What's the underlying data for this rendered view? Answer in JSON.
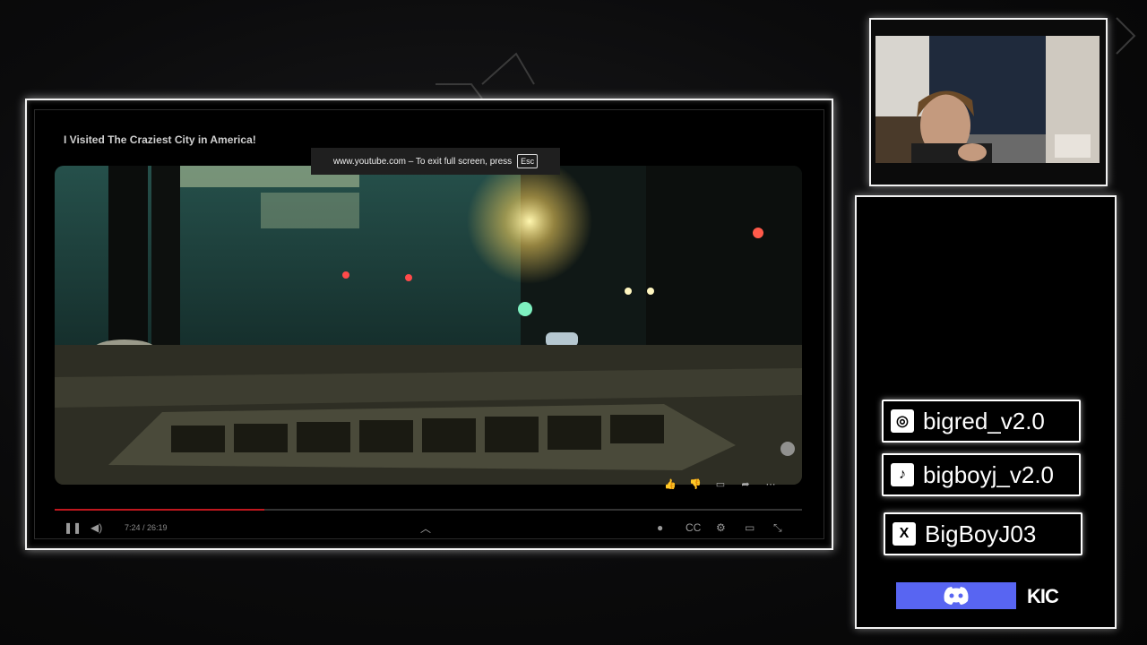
{
  "video": {
    "title": "I Visited The Craziest City in America!",
    "fullscreen_notice": "www.youtube.com – To exit full screen, press",
    "esc_key": "Esc",
    "time": "7:24 / 26:19",
    "progress": 0.28
  },
  "icons": {
    "action_bar": [
      "thumbs-up-icon",
      "thumbs-down-icon",
      "comment-icon",
      "share-icon",
      "more-icon"
    ],
    "controls": [
      "pause-icon",
      "volume-icon",
      "chevron-up-icon",
      "autoplay-icon",
      "captions-icon",
      "settings-icon",
      "cast-icon",
      "exit-fullscreen-icon"
    ]
  },
  "socials": {
    "instagram": "bigred_v2.0",
    "tiktok": "bigboyj_v2.0",
    "x": "BigBoyJ03",
    "kick": "KIC"
  },
  "colors": {
    "progress": "#c0171e",
    "discord": "#5865f2",
    "frame": "#f2f2f2"
  }
}
